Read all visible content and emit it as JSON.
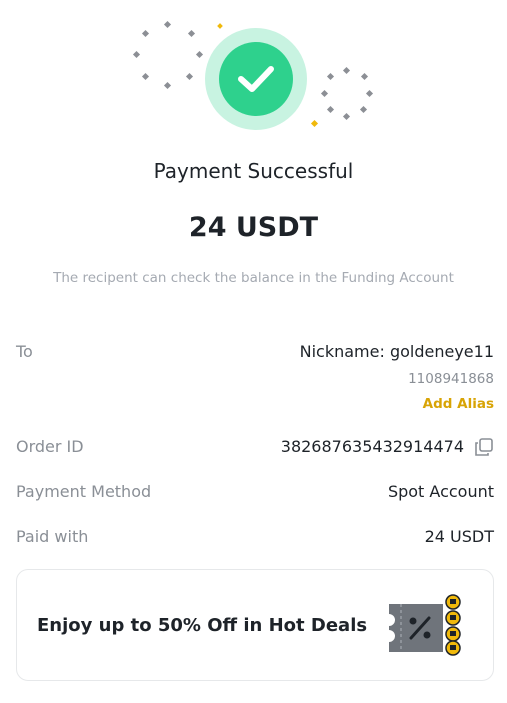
{
  "result": {
    "title": "Payment Successful",
    "amount": "24 USDT",
    "note": "The recipent can check the balance in the Funding Account",
    "status_icon": "check-circle-icon",
    "accent_color": "#2ed18d"
  },
  "details": {
    "to": {
      "label": "To",
      "nickname": "Nickname: goldeneye11",
      "user_id": "1108941868",
      "add_alias": "Add Alias"
    },
    "order": {
      "label": "Order ID",
      "value": "382687635432914474",
      "copy_icon": "copy-icon"
    },
    "method": {
      "label": "Payment Method",
      "value": "Spot Account"
    },
    "paid": {
      "label": "Paid with",
      "value": "24 USDT"
    }
  },
  "promo": {
    "text": "Enjoy up to 50% Off in Hot Deals",
    "icon": "discount-ticket-icon",
    "brand_color": "#f0b90b"
  }
}
